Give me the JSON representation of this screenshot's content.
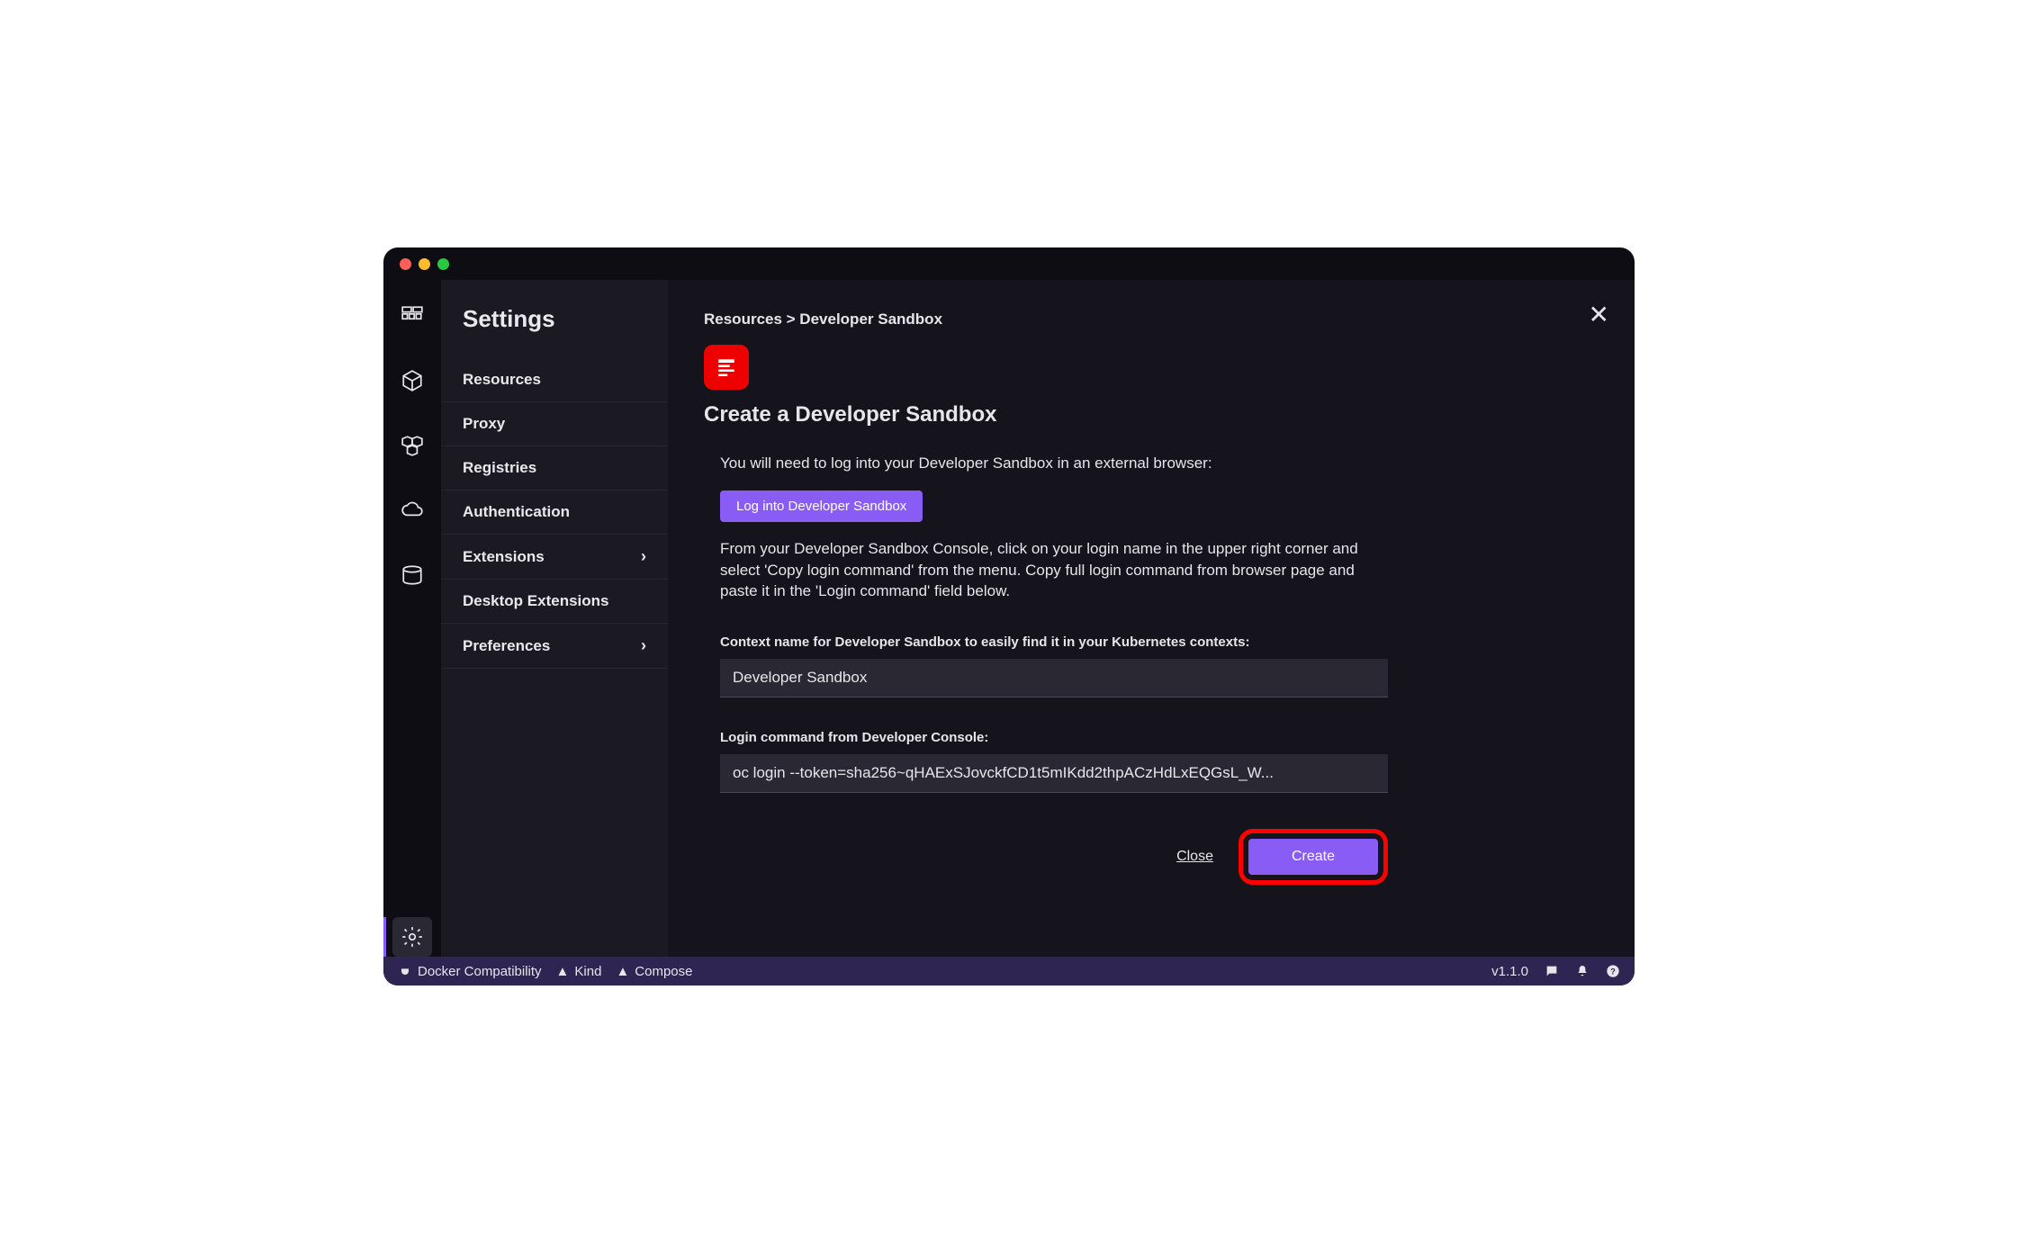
{
  "sidebar": {
    "title": "Settings",
    "items": [
      {
        "label": "Resources",
        "hasChevron": false
      },
      {
        "label": "Proxy",
        "hasChevron": false
      },
      {
        "label": "Registries",
        "hasChevron": false
      },
      {
        "label": "Authentication",
        "hasChevron": false
      },
      {
        "label": "Extensions",
        "hasChevron": true
      },
      {
        "label": "Desktop Extensions",
        "hasChevron": false
      },
      {
        "label": "Preferences",
        "hasChevron": true
      }
    ]
  },
  "main": {
    "breadcrumb": "Resources > Developer Sandbox",
    "title": "Create a Developer Sandbox",
    "intro": "You will need to log into your Developer Sandbox in an external browser:",
    "loginButton": "Log into Developer Sandbox",
    "instructions": "From your Developer Sandbox Console, click on your login name in the upper right corner and select 'Copy login command' from the menu. Copy full login command from browser page and paste it in the 'Login command' field below.",
    "fields": {
      "contextName": {
        "label": "Context name for Developer Sandbox to easily find it in your Kubernetes contexts:",
        "value": "Developer Sandbox"
      },
      "loginCommand": {
        "label": "Login command from Developer Console:",
        "value": "oc login --token=sha256~qHAExSJovckfCD1t5mIKdd2thpACzHdLxEQGsL_W..."
      }
    },
    "actions": {
      "close": "Close",
      "create": "Create"
    }
  },
  "statusbar": {
    "dockerCompat": "Docker Compatibility",
    "kind": "Kind",
    "compose": "Compose",
    "version": "v1.1.0"
  }
}
